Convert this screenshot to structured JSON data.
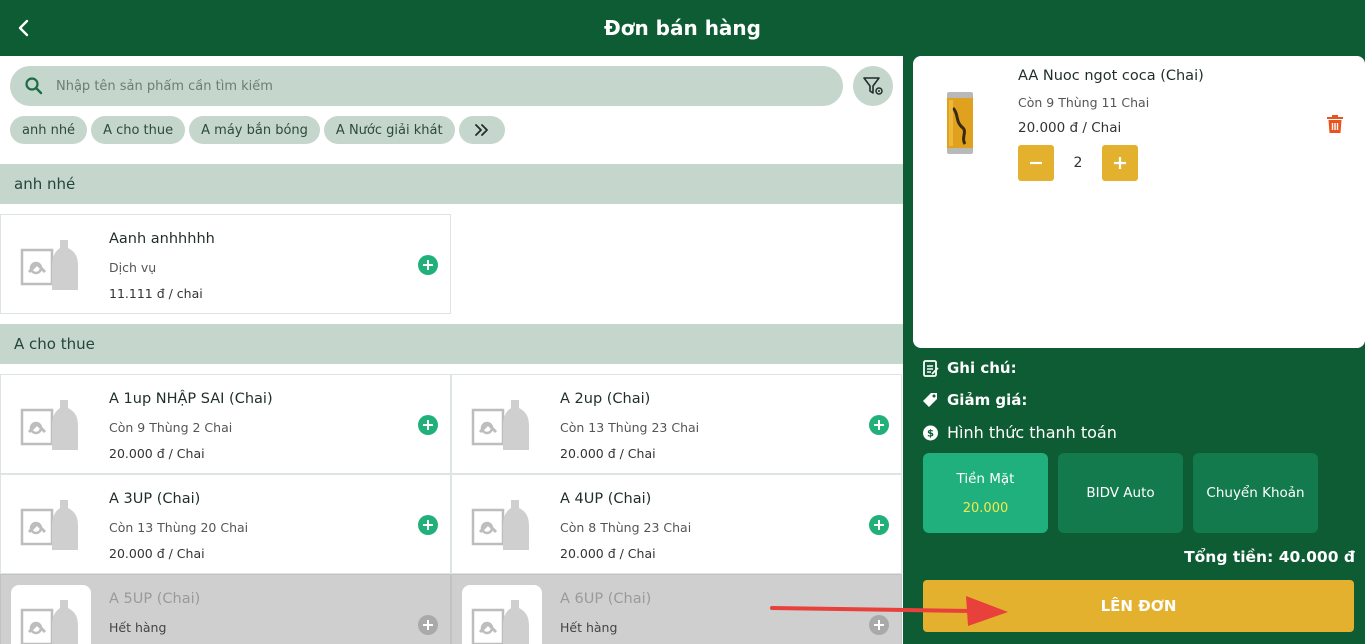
{
  "header": {
    "title": "Đơn bán hàng"
  },
  "search": {
    "placeholder": "Nhập tên sản phẩm cần tìm kiếm"
  },
  "chips": [
    "anh nhé",
    "A cho thue",
    "A máy bắn bóng",
    "A Nước giải khát"
  ],
  "categories": [
    {
      "name": "anh nhé",
      "products": [
        {
          "name": "Aanh anhhhhh",
          "stock": "Dịch vụ",
          "price": "11.111 đ / chai"
        }
      ]
    },
    {
      "name": "A cho thue",
      "products": [
        {
          "name": "A 1up NHẬP SAI (Chai)",
          "stock": "Còn 9 Thùng 2 Chai",
          "price": "20.000 đ / Chai"
        },
        {
          "name": "A 2up (Chai)",
          "stock": "Còn 13 Thùng 23 Chai",
          "price": "20.000 đ / Chai"
        },
        {
          "name": "A 3UP (Chai)",
          "stock": "Còn 13 Thùng 20 Chai",
          "price": "20.000 đ / Chai"
        },
        {
          "name": "A 4UP (Chai)",
          "stock": "Còn 8 Thùng 23 Chai",
          "price": "20.000 đ / Chai"
        },
        {
          "name": "A 5UP (Chai)",
          "stock": "Hết hàng"
        },
        {
          "name": "A 6UP (Chai)",
          "stock": "Hết hàng"
        }
      ]
    }
  ],
  "cart": {
    "items": [
      {
        "name": "AA Nuoc ngot coca (Chai)",
        "stock": "Còn 9 Thùng 11 Chai",
        "price": "20.000 đ / Chai",
        "qty": "2"
      }
    ]
  },
  "options": {
    "note_label": "Ghi chú:",
    "discount_label": "Giảm giá:",
    "payment_label": "Hình thức thanh toán"
  },
  "payment_methods": [
    {
      "label": "Tiền Mặt",
      "amount": "20.000",
      "selected": true
    },
    {
      "label": "BIDV Auto"
    },
    {
      "label": "Chuyển Khoản"
    }
  ],
  "total": "Tổng tiền: 40.000 đ",
  "submit_label": "LÊN ĐƠN",
  "colors": {
    "header_bg": "#0e5c34",
    "accent_yellow": "#e3b12d",
    "add_green": "#21b07a",
    "chip_bg": "#c5d6cc",
    "selected_payment": "#1fb07e"
  }
}
